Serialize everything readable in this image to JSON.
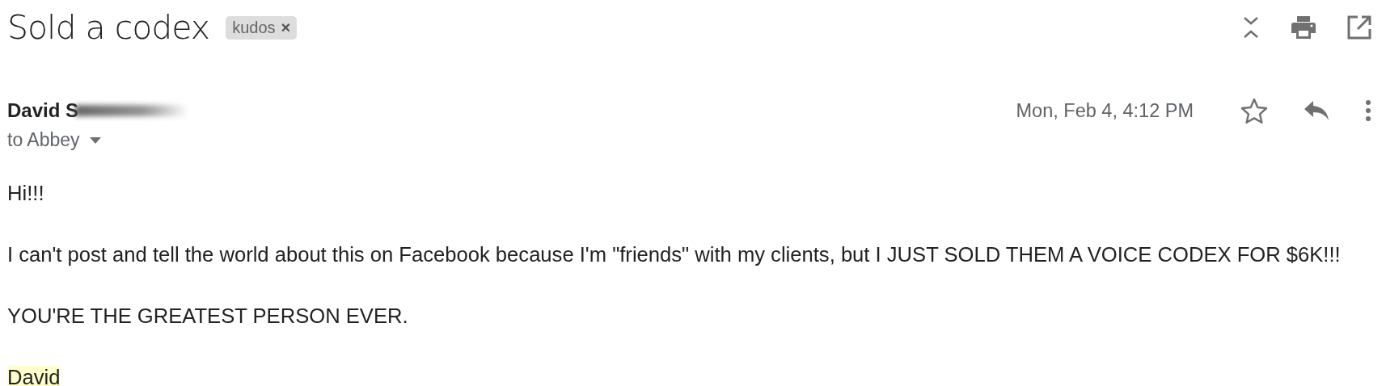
{
  "subject": "Sold a codex",
  "label": {
    "text": "kudos",
    "remove": "×"
  },
  "message": {
    "sender": "David S",
    "sender_redacted": true,
    "recipient": "to Abbey",
    "date": "Mon, Feb 4, 4:12 PM",
    "starred": false,
    "body": [
      {
        "text": "Hi!!!",
        "highlighted": false
      },
      {
        "text": "I can't post and tell the world about this on Facebook because I'm \"friends\" with my clients, but I JUST SOLD THEM A VOICE CODEX FOR $6K!!!",
        "highlighted": false
      },
      {
        "text": "YOU'RE THE GREATEST PERSON EVER.",
        "highlighted": false
      },
      {
        "text": "David",
        "highlighted": true
      }
    ]
  }
}
